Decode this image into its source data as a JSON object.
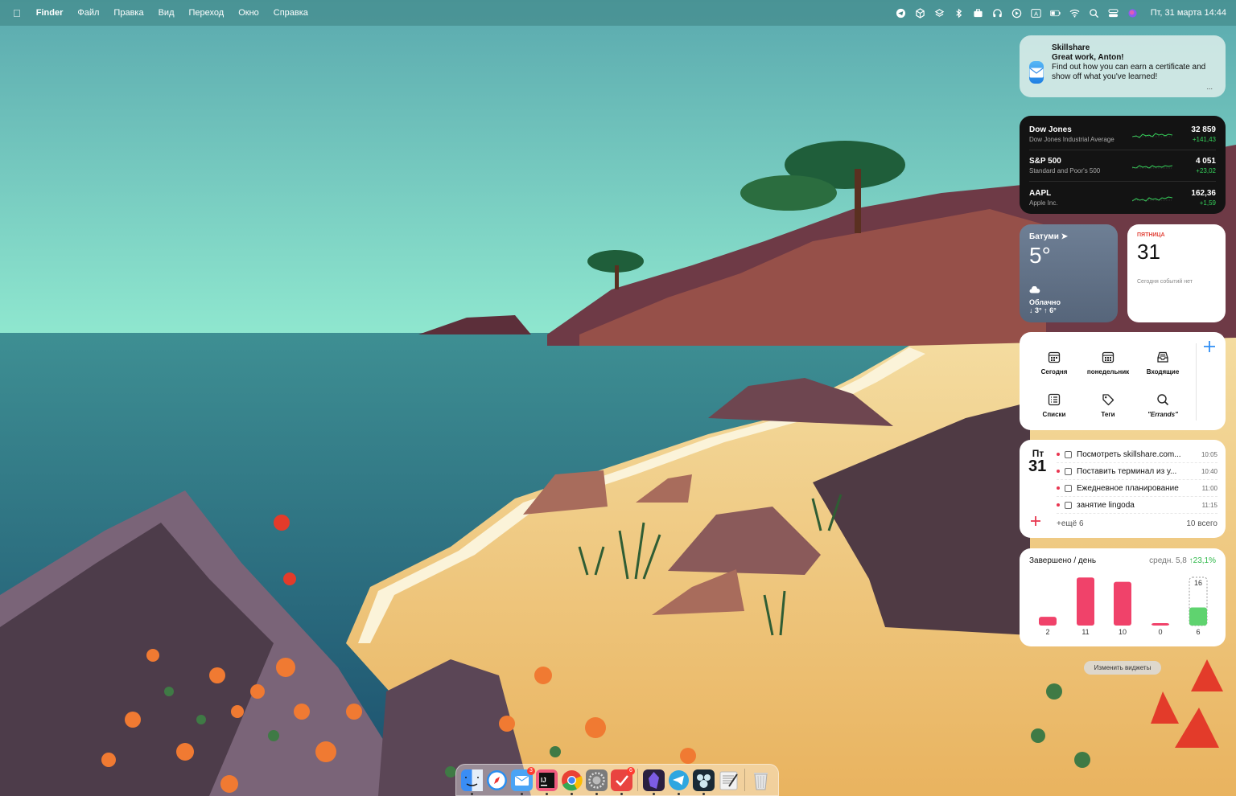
{
  "menubar": {
    "app_name": "Finder",
    "menus": [
      "Файл",
      "Правка",
      "Вид",
      "Переход",
      "Окно",
      "Справка"
    ],
    "status_icons": [
      "telegram-icon",
      "box-icon",
      "layers-icon",
      "bluetooth-icon",
      "briefcase-icon",
      "headphones-icon",
      "play-icon",
      "input-source-icon",
      "battery-icon",
      "wifi-icon",
      "spotlight-icon",
      "control-center-icon",
      "siri-icon"
    ],
    "input_source": "A",
    "clock": "Пт, 31 марта  14:44"
  },
  "notification": {
    "app": "Skillshare",
    "title": "Great work, Anton!",
    "body": "Find out how you can earn a certificate and show off what you've learned!",
    "more": "..."
  },
  "stocks": [
    {
      "symbol": "Dow Jones",
      "name": "Dow Jones Industrial Average",
      "price": "32 859",
      "change": "+141,43"
    },
    {
      "symbol": "S&P 500",
      "name": "Standard and Poor's 500",
      "price": "4 051",
      "change": "+23,02"
    },
    {
      "symbol": "AAPL",
      "name": "Apple Inc.",
      "price": "162,36",
      "change": "+1,59"
    }
  ],
  "weather": {
    "city": "Батуми",
    "temp": "5°",
    "condition": "Облачно",
    "range": "↓ 3° ↑ 6°"
  },
  "calendar": {
    "weekday": "ПЯТНИЦА",
    "day": "31",
    "no_events": "Сегодня событий нет"
  },
  "things": {
    "items": [
      {
        "label": "Сегодня",
        "icon": "calendar-icon"
      },
      {
        "label": "понедельник",
        "icon": "calendar-grid-icon"
      },
      {
        "label": "Входящие",
        "icon": "inbox-icon"
      },
      {
        "label": "Списки",
        "icon": "list-icon"
      },
      {
        "label": "Теги",
        "icon": "tag-icon"
      },
      {
        "label": "\"Errands\"",
        "icon": "search-icon"
      }
    ]
  },
  "todo": {
    "weekday": "Пт",
    "day": "31",
    "tasks": [
      {
        "title": "Посмотреть skillshare.com...",
        "time": "10:05"
      },
      {
        "title": "Поставить терминал из у...",
        "time": "10:40"
      },
      {
        "title": "Ежедневное планирование",
        "time": "11:00"
      },
      {
        "title": "занятие lingoda",
        "time": "11:15"
      }
    ],
    "more": "+ещё 6",
    "total": "10 всего"
  },
  "stats": {
    "title": "Завершено / день",
    "avg_label": "средн. 5,8",
    "trend": "↑23,1%",
    "goal_label": "16",
    "colors": {
      "bar": "#f0426a",
      "today": "#5fd36f"
    }
  },
  "chart_data": {
    "type": "bar",
    "categories": [
      "",
      "",
      "",
      "",
      ""
    ],
    "values": [
      2,
      11,
      10,
      0,
      6
    ],
    "goal": 16,
    "title": "Завершено / день"
  },
  "edit_widgets": "Изменить виджеты",
  "dock": {
    "apps": [
      {
        "name": "finder-icon",
        "color": "#3a8df5"
      },
      {
        "name": "safari-icon",
        "color": "#2a8ef0"
      },
      {
        "name": "mail-icon",
        "color": "#4aa4f5",
        "badge": "3"
      },
      {
        "name": "intellij-icon",
        "color": "#111111"
      },
      {
        "name": "chrome-icon",
        "color": "#e9e9e9"
      },
      {
        "name": "system-settings-icon",
        "color": "#7b7b7b"
      },
      {
        "name": "todoist-icon",
        "color": "#e94440",
        "badge": "6"
      },
      {
        "name": "obsidian-icon",
        "color": "#5b3bb5"
      },
      {
        "name": "telegram-icon",
        "color": "#2ea6e0"
      },
      {
        "name": "mastodon-icon",
        "color": "#1a2a36"
      },
      {
        "name": "textedit-icon",
        "color": "#f2f2f2"
      },
      {
        "name": "trash-icon",
        "color": "#d8d8d8"
      }
    ]
  }
}
